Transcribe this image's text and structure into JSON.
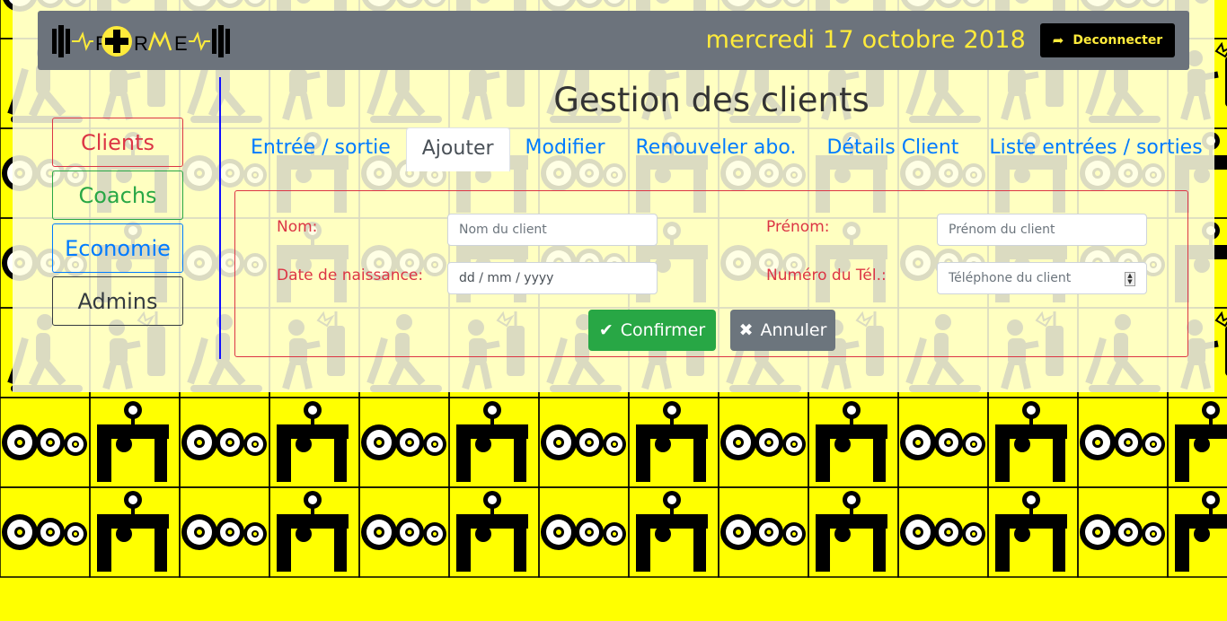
{
  "header": {
    "date": "mercredi 17 octobre 2018",
    "logout_label": "Deconnecter"
  },
  "sidebar": {
    "items": [
      {
        "label": "Clients"
      },
      {
        "label": "Coachs"
      },
      {
        "label": "Economie"
      },
      {
        "label": "Admins"
      }
    ]
  },
  "main": {
    "title": "Gestion des clients",
    "tabs": [
      {
        "label": "Entrée / sortie"
      },
      {
        "label": "Ajouter"
      },
      {
        "label": "Modifier"
      },
      {
        "label": "Renouveler abo."
      },
      {
        "label": "Détails Client"
      },
      {
        "label": "Liste entrées / sorties"
      }
    ],
    "active_tab": "Ajouter"
  },
  "form": {
    "nom_label": "Nom:",
    "nom_placeholder": "Nom du client",
    "prenom_label": "Prénom:",
    "prenom_placeholder": "Prénom du client",
    "dob_label": "Date de naissance:",
    "dob_placeholder": "dd / mm / yyyy",
    "tel_label": "Numéro du Tél.:",
    "tel_placeholder": "Téléphone du client",
    "confirm_label": "Confirmer",
    "cancel_label": "Annuler"
  },
  "colors": {
    "background": "#ffff00",
    "topbar": "#6c737c",
    "date_text": "#ffeb3b",
    "danger": "#dc3545",
    "success": "#28a745",
    "primary": "#007bff"
  }
}
